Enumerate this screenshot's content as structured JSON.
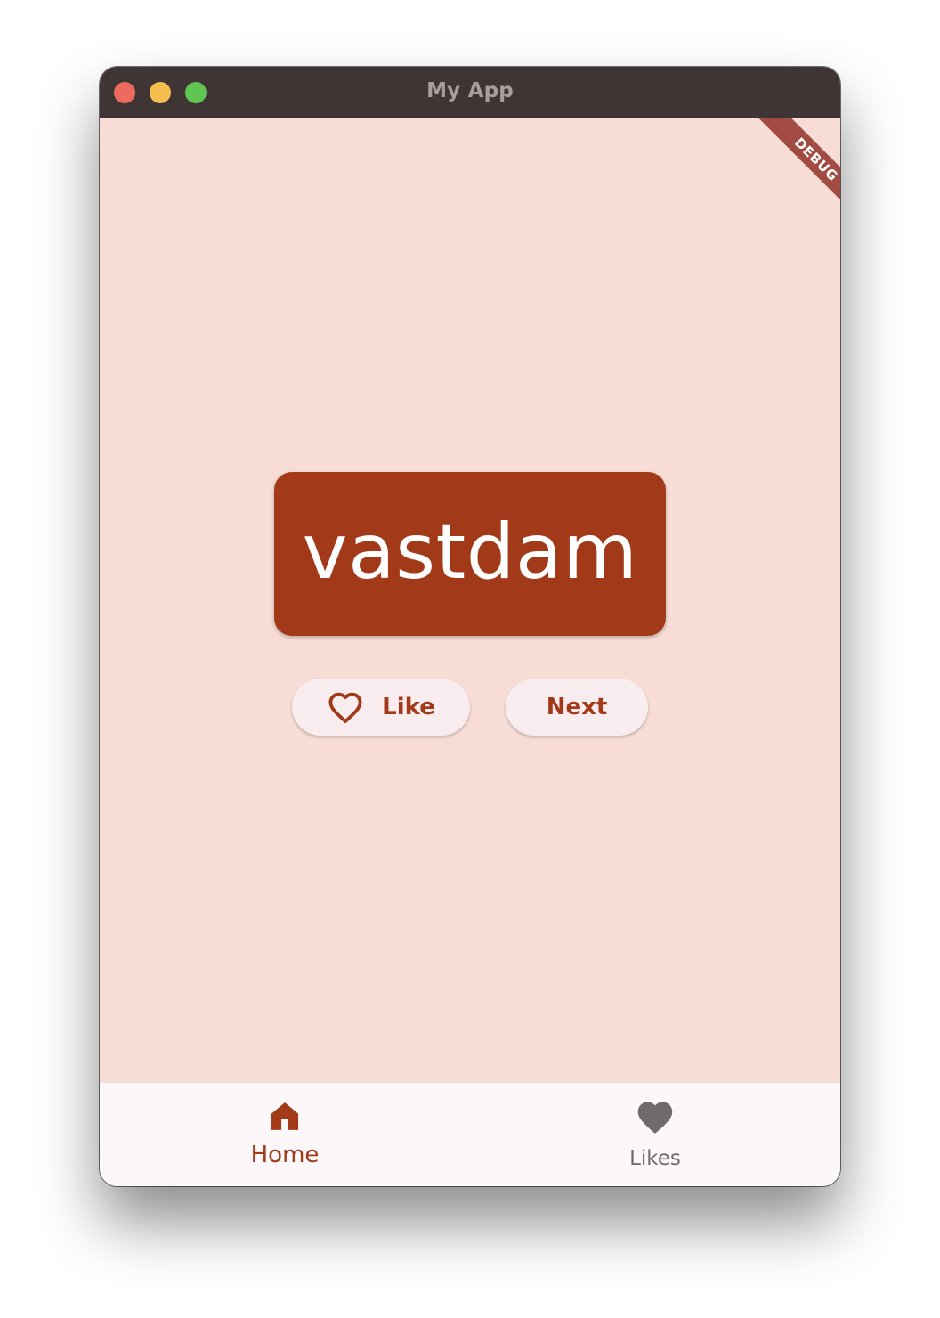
{
  "window": {
    "title": "My App"
  },
  "debug_banner": {
    "label": "DEBUG"
  },
  "main": {
    "word": "vastdam",
    "like_button": {
      "label": "Like",
      "icon": "heart-outline-icon"
    },
    "next_button": {
      "label": "Next"
    }
  },
  "nav": {
    "items": [
      {
        "label": "Home",
        "icon": "home-icon",
        "selected": true
      },
      {
        "label": "Likes",
        "icon": "heart-icon",
        "selected": false
      }
    ]
  },
  "colors": {
    "primary": "#a23918",
    "background": "#f7ddd5",
    "button_surface": "#f8ecee",
    "nav_surface": "#fcf7f9",
    "inactive": "#6f6b6c",
    "titlebar": "#3f3534"
  }
}
